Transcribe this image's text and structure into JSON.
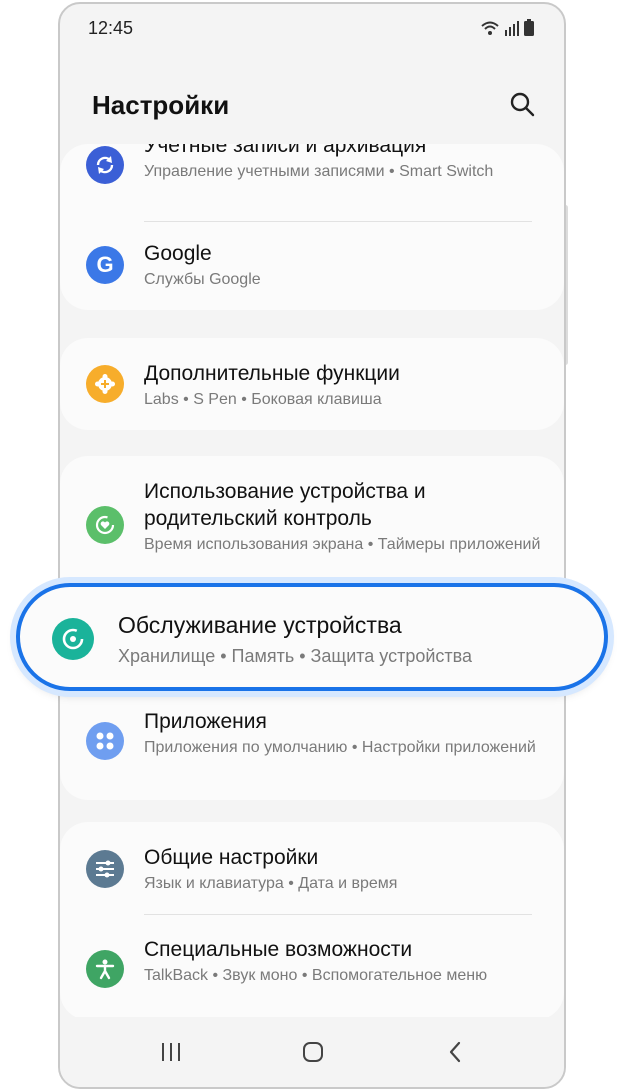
{
  "status_bar": {
    "time": "12:45"
  },
  "header": {
    "title": "Настройки"
  },
  "cards": {
    "accounts": {
      "items": [
        {
          "label": "Учетные записи и архивация",
          "sub": "Управление учетными записями • Smart Switch",
          "icon": "sync-icon",
          "color": "#3b5fd6"
        },
        {
          "label": "Google",
          "sub": "Службы Google",
          "icon": "google-icon",
          "color": "#3b78e7"
        }
      ]
    },
    "advanced": {
      "items": [
        {
          "label": "Дополнительные функции",
          "sub": "Labs  •  S Pen  •  Боковая клавиша",
          "icon": "plus-gear-icon",
          "color": "#f7ad2b"
        }
      ]
    },
    "device": {
      "items": [
        {
          "label": "Использование устройства и родительский контроль",
          "sub": "Время использования экрана • Таймеры приложений",
          "icon": "wellbeing-icon",
          "color": "#5bbf6a"
        },
        {
          "label": "Приложения",
          "sub": "Приложения по умолчанию • Настройки приложений",
          "icon": "apps-icon",
          "color": "#6f9ef0"
        }
      ]
    },
    "general": {
      "items": [
        {
          "label": "Общие настройки",
          "sub": "Язык и клавиатура  •  Дата и время",
          "icon": "sliders-icon",
          "color": "#5c7a92"
        },
        {
          "label": "Специальные возможности",
          "sub": "TalkBack • Звук моно • Вспомогательное меню",
          "icon": "accessibility-icon",
          "color": "#3fa564"
        }
      ]
    }
  },
  "highlight": {
    "label": "Обслуживание устройства",
    "sub": "Хранилище  •  Память  •  Защита устройства",
    "icon": "device-care-icon",
    "color": "#1ab39a"
  },
  "navbar": {
    "recent": "recent-apps-icon",
    "home": "home-icon",
    "back": "back-icon"
  }
}
